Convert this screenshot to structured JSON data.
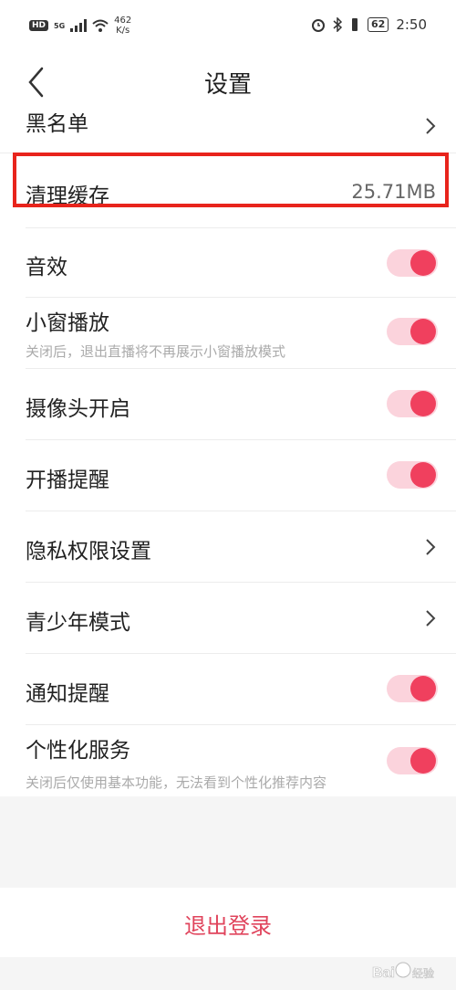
{
  "status_bar": {
    "network_badge": "HD",
    "net_type": "5G",
    "speed_value": "462",
    "speed_unit": "K/s",
    "battery": "62",
    "time": "2:50"
  },
  "header": {
    "title": "设置"
  },
  "rows": [
    {
      "label": "黑名单",
      "kind": "link"
    },
    {
      "label": "清理缓存",
      "value": "25.71MB",
      "kind": "value"
    },
    {
      "label": "音效",
      "kind": "toggle",
      "on": true
    },
    {
      "label": "小窗播放",
      "sub": "关闭后，退出直播将不再展示小窗播放模式",
      "kind": "toggle",
      "on": true
    },
    {
      "label": "摄像头开启",
      "kind": "toggle",
      "on": true
    },
    {
      "label": "开播提醒",
      "kind": "toggle",
      "on": true
    },
    {
      "label": "隐私权限设置",
      "kind": "link"
    },
    {
      "label": "青少年模式",
      "kind": "link"
    },
    {
      "label": "通知提醒",
      "kind": "toggle",
      "on": true
    },
    {
      "label": "个性化服务",
      "sub": "关闭后仅使用基本功能，无法看到个性化推荐内容",
      "kind": "toggle",
      "on": true
    }
  ],
  "logout_label": "退出登录",
  "watermark_text": "Baidu经验",
  "colors": {
    "accent": "#f0405e",
    "toggle_track": "#fbd3dc",
    "highlight": "#e8241c",
    "logout": "#e0445c"
  }
}
